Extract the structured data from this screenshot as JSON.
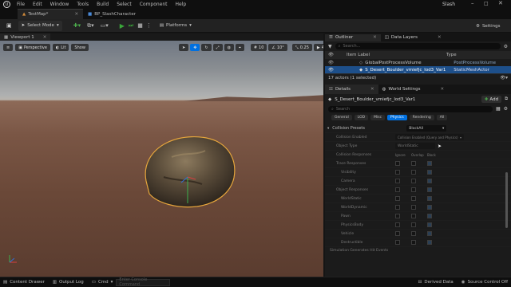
{
  "app": {
    "title": "Slash"
  },
  "menu": [
    "File",
    "Edit",
    "Window",
    "Tools",
    "Build",
    "Select",
    "Component",
    "Help"
  ],
  "tabs": [
    {
      "label": "TestMap*"
    },
    {
      "label": "BP_SlashCharacter"
    }
  ],
  "toolbar": {
    "select_mode": "Select Mode",
    "platforms": "Platforms",
    "settings": "Settings"
  },
  "viewport": {
    "tab": "Viewport 1",
    "perspective": "Perspective",
    "lit": "Lit",
    "show": "Show",
    "grid_value": "10",
    "angle_value": "10°",
    "scale_value": "0.25",
    "camera_speed": "4"
  },
  "outliner": {
    "tab": "Outliner",
    "tab2": "Data Layers",
    "search_placeholder": "Search...",
    "col_label": "Item Label",
    "col_type": "Type",
    "rows": [
      {
        "label": "GlobalPostProcessVolume",
        "type": "PostProcessVolume"
      },
      {
        "label": "S_Desert_Boulder_vmiefjc_lod3_Var1",
        "type": "StaticMeshActor"
      }
    ],
    "count": "17 actors (1 selected)"
  },
  "details": {
    "tab": "Details",
    "tab2": "World Settings",
    "actor_name": "S_Desert_Boulder_vmiefjc_lod3_Var1",
    "add_label": "Add",
    "search_placeholder": "Search",
    "filters": [
      "General",
      "LOD",
      "Misc",
      "Physics",
      "Rendering",
      "All"
    ],
    "active_filter": "Physics",
    "collision_presets_label": "Collision Presets",
    "collision_presets_value": "BlockAll",
    "collision_enabled_label": "Collision Enabled",
    "collision_enabled_value": "Collision Enabled (Query and Physics)",
    "object_type_label": "Object Type",
    "object_type_value": "WorldStatic",
    "responses_label": "Collision Responses",
    "col_ignore": "Ignore",
    "col_overlap": "Overlap",
    "col_block": "Block",
    "trace_label": "Trace Responses",
    "trace_rows": [
      "Visibility",
      "Camera"
    ],
    "object_label": "Object Responses",
    "object_rows": [
      "WorldStatic",
      "WorldDynamic",
      "Pawn",
      "PhysicsBody",
      "Vehicle",
      "Destructible"
    ],
    "last_row": "Simulation Generates Hit Events"
  },
  "statusbar": {
    "content_drawer": "Content Drawer",
    "output_log": "Output Log",
    "cmd": "Cmd",
    "console_placeholder": "Enter Console Command",
    "derived_data": "Derived Data",
    "source_control": "Source Control Off"
  },
  "colors": {
    "accent": "#0070e0",
    "selection": "#1d4f8a",
    "play": "#3aa63a",
    "boulder_outline": "#e6a63c"
  }
}
